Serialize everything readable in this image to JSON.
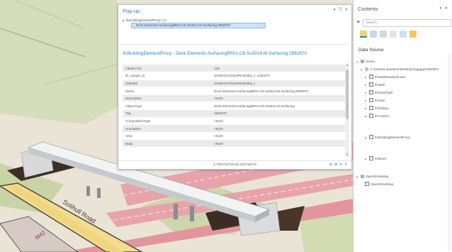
{
  "popup": {
    "title": "Pop-up",
    "controls": {
      "dropdown": "▾",
      "restore": "❐",
      "close": "✕"
    },
    "layer": {
      "caret": "▴",
      "label": "IfcBuildingElementProxy",
      "count": "(1)"
    },
    "feature_row": "Deck Elements-SurfacingBR01:C8-Ss3014-M-Surfacing:2882870",
    "feature_title": "IfcBuildingElementProxy - Deck Elements-SurfacingBR01:C8-Ss3014-M-Surfacing:2882870",
    "attributes": [
      {
        "key": "OBJECTID",
        "value": "148"
      },
      {
        "key": "ifc_unique_id",
        "value": "2m0k2mCzf1kwPko3D8ba_t_1330370"
      },
      {
        "key": "GlobalId",
        "value": "2m0k2mCzf1kwPko3D8ba_t"
      },
      {
        "key": "Name",
        "value": "Deck Elements-SurfacingBR01:C8-Ss3014-M-Surfacing:2882870"
      },
      {
        "key": "Description",
        "value": "<Null>"
      },
      {
        "key": "ObjectType",
        "value": "Deck Elements-SurfacingBR01:C8-Ss3014-M-Surfacing"
      },
      {
        "key": "Tag",
        "value": "2882870"
      },
      {
        "key": "CompositionType",
        "value": "<Null>"
      },
      {
        "key": "Annotation",
        "value": "<Null>"
      },
      {
        "key": "Area",
        "value": "<Null>"
      },
      {
        "key": "Body",
        "value": "<Null>"
      }
    ],
    "coordinates": "1.7204710°W 52.4237116°N",
    "statusbar_tools": [
      "⊕",
      "⊞",
      "✕",
      "⚲"
    ]
  },
  "contents": {
    "title": "Contents",
    "controls": {
      "dropdown": "▾",
      "close": "✕"
    },
    "search": {
      "placeholder": "Search"
    },
    "section_title": "Data Source",
    "tree": [
      {
        "label": "Scene",
        "level": 0,
        "caret": "▴",
        "checkbox": false
      },
      {
        "label": "C:\\Users\\a.skarlatos\\Desktop\\z\\gpgpg\\z\\b00001",
        "level": 1,
        "caret": "▴",
        "checkbox": false
      },
      {
        "label": "IfcWallStandardCase",
        "level": 2,
        "caret": "▸",
        "checkbox": true
      },
      {
        "label": "IfcWall",
        "level": 2,
        "caret": "▸",
        "checkbox": true
      },
      {
        "label": "IfcStairFlight",
        "level": 2,
        "caret": "▸",
        "checkbox": true
      },
      {
        "label": "IfcSlab",
        "level": 2,
        "caret": "▸",
        "checkbox": true
      },
      {
        "label": "IfcRailing",
        "level": 2,
        "caret": "▸",
        "checkbox": true
      },
      {
        "label": "IfcColumn",
        "level": 2,
        "caret": "▴",
        "checkbox": true
      },
      {
        "label": "IfcBuildingElementProxy",
        "level": 2,
        "caret": "▴",
        "checkbox": true
      },
      {
        "label": "IfcBeam",
        "level": 2,
        "caret": "▴",
        "checkbox": true
      },
      {
        "label": "OpenStreetMap",
        "level": 0,
        "caret": "▴",
        "checkbox": false
      },
      {
        "label": "OpenStreetMap",
        "level": 1,
        "caret": "",
        "checkbox": true
      }
    ]
  },
  "map": {
    "road_label": "Solihull Road",
    "shield_label": "M42"
  },
  "colors": {
    "accent": "#2c7fc4",
    "highlight": "#cce3f5",
    "road_pink": "#e8a0a8",
    "ground": "#e9e4d6",
    "grass": "#cfd9b0"
  }
}
